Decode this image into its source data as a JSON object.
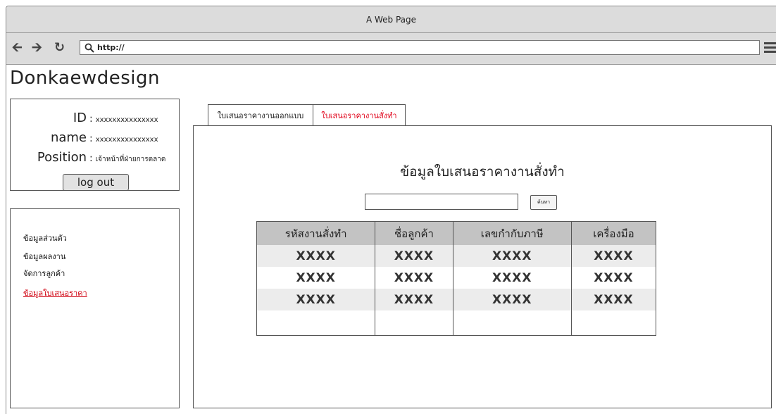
{
  "window": {
    "title": "A Web Page"
  },
  "browser": {
    "url": "http://"
  },
  "brand": "Donkaewdesign",
  "profile": {
    "id_label": "ID",
    "id_value": "xxxxxxxxxxxxxxx",
    "name_label": "name",
    "name_value": "xxxxxxxxxxxxxxx",
    "position_label": "Position",
    "position_value": "เจ้าหน้าที่ฝ่ายการตลาด",
    "logout_label": "log out"
  },
  "sidebar": {
    "items": [
      {
        "label": "ข้อมูลส่วนตัว",
        "active": false
      },
      {
        "label": "ข้อมูลผลงาน",
        "active": false
      },
      {
        "label": "จัดการลูกค้า",
        "active": false
      },
      {
        "label": "ข้อมูลใบเสนอราคา",
        "active": true
      }
    ]
  },
  "tabs": [
    {
      "label": "ใบเสนอราคางานออกแบบ",
      "active": false
    },
    {
      "label": "ใบเสนอราคางานสั่งทำ",
      "active": true
    }
  ],
  "panel": {
    "title": "ข้อมูลใบเสนอราคางานสั่งทำ",
    "search_value": "",
    "search_button": "ค้นหา",
    "columns": [
      "รหัสงานสั่งทำ",
      "ชื่อลูกค้า",
      "เลขกำกับภาษี",
      "เครื่องมือ"
    ],
    "rows": [
      [
        "XXXX",
        "XXXX",
        "XXXX",
        "XXXX"
      ],
      [
        "XXXX",
        "XXXX",
        "XXXX",
        "XXXX"
      ],
      [
        "XXXX",
        "XXXX",
        "XXXX",
        "XXXX"
      ],
      [
        "",
        "",
        "",
        ""
      ]
    ]
  },
  "colors": {
    "active_link": "#d0000f",
    "header_bg": "#c3c3c3",
    "chrome_bg": "#dcdcdc"
  }
}
